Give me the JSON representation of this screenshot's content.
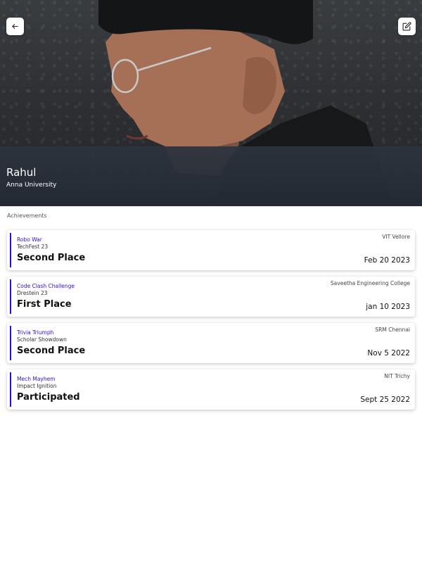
{
  "profile": {
    "name": "Rahul",
    "university": "Anna University"
  },
  "header": {
    "back_icon": "arrow-left-icon",
    "edit_icon": "edit-pencil-icon"
  },
  "section": {
    "title": "Achievements"
  },
  "achievements": [
    {
      "event": "Robo War",
      "fest": "TechFest 23",
      "result": "Second Place",
      "venue": "VIT Vellore",
      "date": "Feb 20 2023"
    },
    {
      "event": "Code Clash Challenge",
      "fest": "Drestein 23",
      "result": "First Place",
      "venue": "Saveetha Engineering College",
      "date": "jan 10 2023"
    },
    {
      "event": "Trivia Triumph",
      "fest": "Scholar Showdown",
      "result": "Second Place",
      "venue": "SRM Chennai",
      "date": "Nov 5 2022"
    },
    {
      "event": "Mech Mayhem",
      "fest": "Impact Ignition",
      "result": "Participated",
      "venue": "NIT Trichy",
      "date": "Sept 25 2022"
    }
  ],
  "colors": {
    "accent": "#2a12d6",
    "overlay": "#2d343e"
  }
}
